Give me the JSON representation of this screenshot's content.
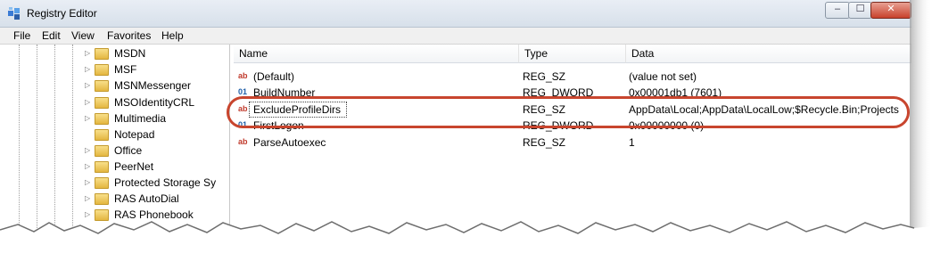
{
  "window": {
    "title": "Registry Editor"
  },
  "controls": {
    "minimize": "–",
    "maximize": "☐",
    "close": "✕"
  },
  "menu": [
    {
      "label": "File"
    },
    {
      "label": "Edit"
    },
    {
      "label": "View"
    },
    {
      "label": "Favorites"
    },
    {
      "label": "Help"
    }
  ],
  "tree": {
    "items": [
      {
        "label": "MSDN"
      },
      {
        "label": "MSF"
      },
      {
        "label": "MSNMessenger"
      },
      {
        "label": "MSOIdentityCRL"
      },
      {
        "label": "Multimedia"
      },
      {
        "label": "Notepad"
      },
      {
        "label": "Office"
      },
      {
        "label": "PeerNet"
      },
      {
        "label": "Protected Storage Sy"
      },
      {
        "label": "RAS AutoDial"
      },
      {
        "label": "RAS Phonebook"
      }
    ]
  },
  "columns": {
    "name": "Name",
    "type": "Type",
    "data": "Data"
  },
  "rows": [
    {
      "icon": "string-value-icon",
      "name": "(Default)",
      "type": "REG_SZ",
      "data": "(value not set)"
    },
    {
      "icon": "dword-value-icon",
      "name": "BuildNumber",
      "type": "REG_DWORD",
      "data": "0x00001db1 (7601)"
    },
    {
      "icon": "string-value-icon",
      "name": "ExcludeProfileDirs",
      "type": "REG_SZ",
      "data": "AppData\\Local;AppData\\LocalLow;$Recycle.Bin;Projects"
    },
    {
      "icon": "dword-value-icon",
      "name": "FirstLogon",
      "type": "REG_DWORD",
      "data": "0x00000000 (0)"
    },
    {
      "icon": "string-value-icon",
      "name": "ParseAutoexec",
      "type": "REG_SZ",
      "data": "1"
    }
  ],
  "icon_glyphs": {
    "string": "ab",
    "dword": "01"
  },
  "colors": {
    "highlight": "#c8452e",
    "titlebar": "#dfe6ee"
  }
}
